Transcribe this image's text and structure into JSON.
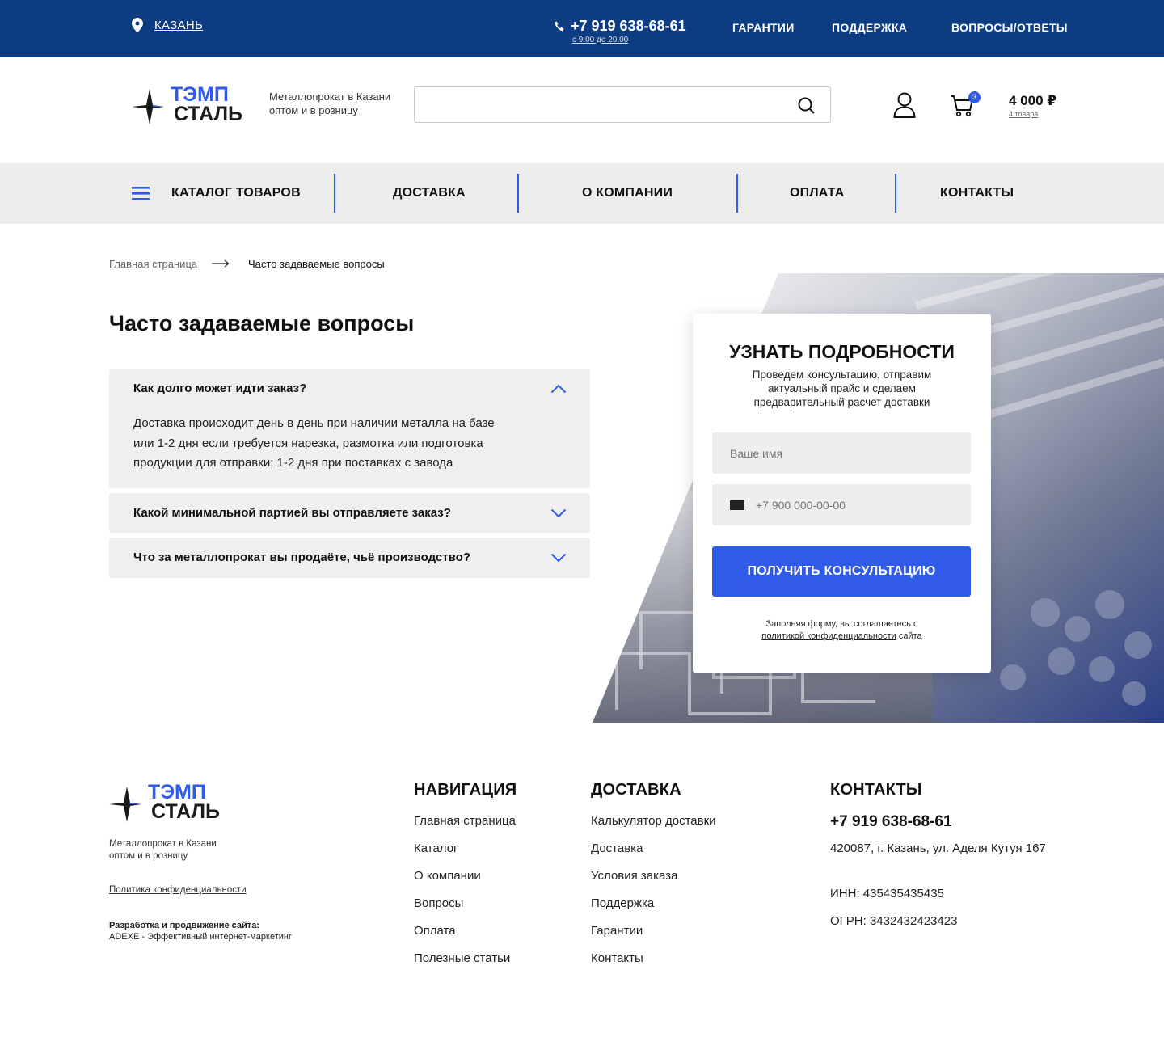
{
  "topbar": {
    "city": "КАЗАНЬ",
    "phone": "+7 919 638-68-61",
    "hours": "с 9:00 до 20:00",
    "links": [
      "ГАРАНТИИ",
      "ПОДДЕРЖКА",
      "ВОПРОСЫ/ОТВЕТЫ"
    ]
  },
  "header": {
    "logo_line1": "ТЭМП",
    "logo_line2": "СТАЛЬ",
    "tagline1": "Металлопрокат в Казани",
    "tagline2": "оптом и в розницу",
    "search_value": "",
    "cart_badge": "3",
    "cart_total": "4 000 ₽",
    "cart_items": "4 товара"
  },
  "nav": {
    "items": [
      "КАТАЛОГ ТОВАРОВ",
      "ДОСТАВКА",
      "О КОМПАНИИ",
      "ОПЛАТА",
      "КОНТАКТЫ"
    ]
  },
  "breadcrumb": {
    "home": "Главная страница",
    "current": "Часто задаваемые вопросы"
  },
  "page": {
    "title": "Часто задаваемые вопросы"
  },
  "faq": [
    {
      "question": "Как долго может идти заказ?",
      "answer_lines": [
        "Доставка происходит день в день при наличии металла на базе",
        "или 1-2 дня если требуется нарезка, размотка или подготовка",
        "продукции для отправки; 1-2 дня при поставках с завода"
      ]
    },
    {
      "question": "Какой минимальной партией вы отправляете заказ?"
    },
    {
      "question": "Что за металлопрокат вы продаёте, чьё производство?"
    }
  ],
  "form": {
    "title": "УЗНАТЬ ПОДРОБНОСТИ",
    "subtitle": "Проведем консультацию, отправим актуальный прайс и сделаем предварительный расчет доставки",
    "name_placeholder": "Ваше имя",
    "phone_placeholder": "+7 900 000-00-00",
    "button": "ПОЛУЧИТЬ КОНСУЛЬТАЦИЮ",
    "consent_text": "Заполняя форму, вы соглашаетесь с",
    "consent_link": "политикой конфиденциальности",
    "consent_tail": "сайта"
  },
  "footer": {
    "tagline1": "Металлопрокат в Казани",
    "tagline2": "оптом и в розницу",
    "privacy": "Политика конфиденциальности",
    "dev_label": "Разработка и продвижение сайта:",
    "dev_text": "ADEXE - Эффективный интернет-маркетинг",
    "nav_title": "НАВИГАЦИЯ",
    "nav_links": [
      "Главная страница",
      "Каталог",
      "О компании",
      "Вопросы",
      "Оплата",
      "Полезные статьи"
    ],
    "delivery_title": "ДОСТАВКА",
    "delivery_links": [
      "Калькулятор доставки",
      "Доставка",
      "Условия заказа",
      "Поддержка",
      "Гарантии",
      "Контакты"
    ],
    "contacts_title": "КОНТАКТЫ",
    "phone": "+7 919 638-68-61",
    "address": "420087,  г. Казань, ул. Аделя Кутуя 167",
    "inn": "ИНН: 435435435435",
    "ogrn": "ОГРН: 3432432423423"
  },
  "colors": {
    "topbar": "#0e3c80",
    "accent": "#2f5be8",
    "nav_bg": "#ececec",
    "faq_bg": "#efefef"
  }
}
